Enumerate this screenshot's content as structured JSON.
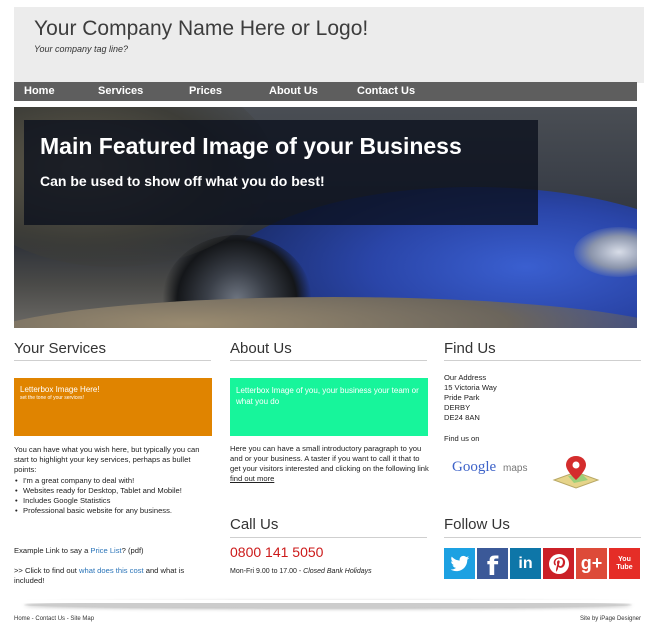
{
  "header": {
    "title": "Your Company Name Here or Logo!",
    "tagline": "Your company tag line?"
  },
  "nav": {
    "items": [
      "Home",
      "Services",
      "Prices",
      "About Us",
      "Contact Us"
    ]
  },
  "hero": {
    "title": "Main Featured Image of your Business",
    "subtitle": "Can be used to show off what you do best!"
  },
  "services": {
    "heading": "Your Services",
    "letterbox_title": "Letterbox Image Here!",
    "letterbox_sub": "set the tone of your services!",
    "intro": "You can have what you wish here, but typically you can start to highlight your key services, perhaps as bullet points:",
    "bullets": [
      "I'm a great company to deal with!",
      "Websites ready for Desktop, Tablet and Mobile!",
      "Includes Google Statistics",
      "Professional basic website for any business."
    ],
    "price_prefix": "Example Link to say a ",
    "price_link": "Price List",
    "price_suffix": "? (pdf)",
    "cost_prefix": ">> Click to find out ",
    "cost_link": "what does this cost",
    "cost_suffix": " and what is included!"
  },
  "about": {
    "heading": "About Us",
    "letterbox_text": "Letterbox Image of you, your business your team or what you do",
    "intro": "Here you can have a small introductory paragraph to you and or your business. A taster if you want to call it that to get your visitors interested and clicking on the following link",
    "link": "find out more"
  },
  "call": {
    "heading": "Call Us",
    "phone": "0800 141 5050",
    "hours_prefix": "Mon-Fri 9.00 to 17.00 - ",
    "hours_closed": "Closed Bank Holidays"
  },
  "find": {
    "heading": "Find Us",
    "address": [
      "Our Address",
      "15 Victoria Way",
      "Pride Park",
      "DERBY",
      "DE24 8AN"
    ],
    "find_us_on": "Find us on",
    "maps_google": "Google",
    "maps_word": "maps"
  },
  "follow": {
    "heading": "Follow Us",
    "icons": [
      {
        "name": "twitter-icon",
        "glyph": "🐦",
        "color": "#1da1e2"
      },
      {
        "name": "facebook-icon",
        "glyph": "f",
        "color": "#3b5998"
      },
      {
        "name": "linkedin-icon",
        "glyph": "in",
        "color": "#0e76a8"
      },
      {
        "name": "pinterest-icon",
        "glyph": "P",
        "color": "#cb2027"
      },
      {
        "name": "google-plus-icon",
        "glyph": "g+",
        "color": "#dd4b39"
      },
      {
        "name": "youtube-icon",
        "glyph": "You Tube",
        "color": "#e52d27"
      }
    ]
  },
  "footer": {
    "links": [
      "Home",
      "Contact Us",
      "Site Map"
    ],
    "separator": " - ",
    "credit": "Site by iPage Designer"
  }
}
